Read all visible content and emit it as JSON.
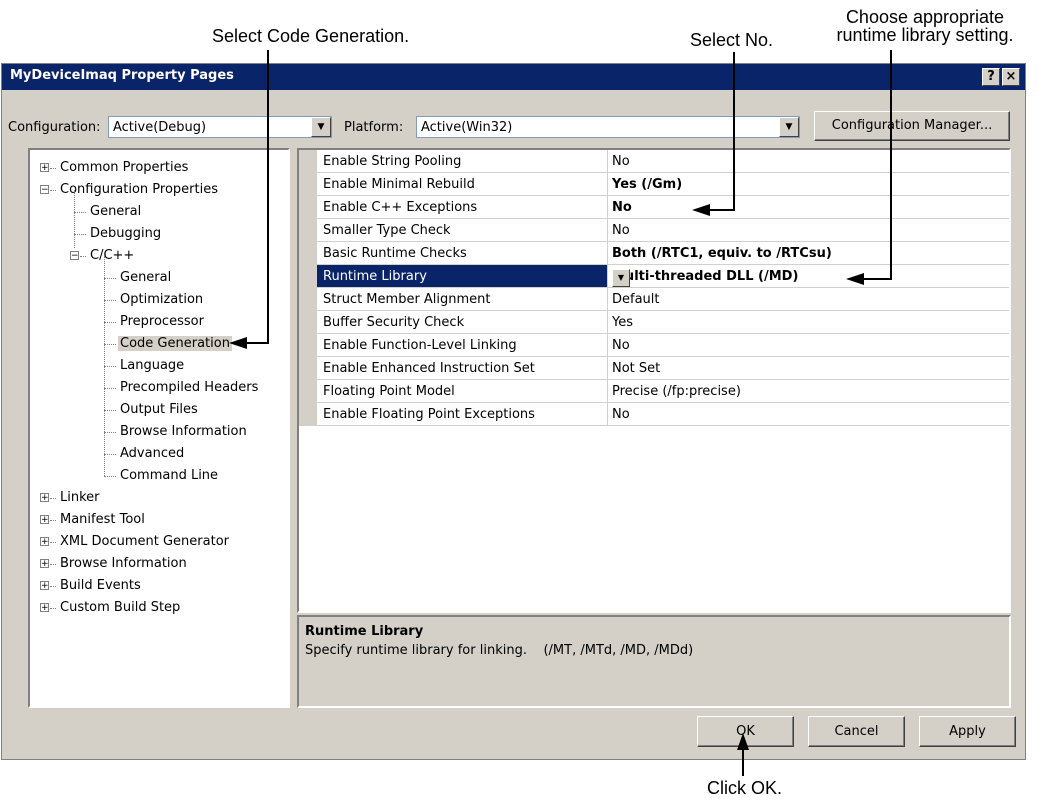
{
  "callouts": {
    "select_code_generation": "Select Code Generation.",
    "select_no": "Select No.",
    "choose_runtime_line1": "Choose appropriate",
    "choose_runtime_line2": "runtime library setting.",
    "click_ok": "Click OK."
  },
  "window": {
    "title": "MyDeviceImaq Property Pages",
    "help_button": "?",
    "close_button": "×"
  },
  "toolbar": {
    "configuration_label": "Configuration:",
    "configuration_value": "Active(Debug)",
    "platform_label": "Platform:",
    "platform_value": "Active(Win32)",
    "configuration_manager": "Configuration Manager..."
  },
  "tree": {
    "items": [
      {
        "label": "Common Properties",
        "expander": "+"
      },
      {
        "label": "Configuration Properties",
        "expander": "−"
      },
      {
        "label": "General"
      },
      {
        "label": "Debugging"
      },
      {
        "label": "C/C++",
        "expander": "−"
      },
      {
        "label": "General"
      },
      {
        "label": "Optimization"
      },
      {
        "label": "Preprocessor"
      },
      {
        "label": "Code Generation",
        "selected": true
      },
      {
        "label": "Language"
      },
      {
        "label": "Precompiled Headers"
      },
      {
        "label": "Output Files"
      },
      {
        "label": "Browse Information"
      },
      {
        "label": "Advanced"
      },
      {
        "label": "Command Line"
      },
      {
        "label": "Linker",
        "expander": "+"
      },
      {
        "label": "Manifest Tool",
        "expander": "+"
      },
      {
        "label": "XML Document Generator",
        "expander": "+"
      },
      {
        "label": "Browse Information",
        "expander": "+"
      },
      {
        "label": "Build Events",
        "expander": "+"
      },
      {
        "label": "Custom Build Step",
        "expander": "+"
      }
    ]
  },
  "properties": {
    "rows": [
      {
        "name": "Enable String Pooling",
        "value": "No"
      },
      {
        "name": "Enable Minimal Rebuild",
        "value": "Yes (/Gm)",
        "bold": true
      },
      {
        "name": "Enable C++ Exceptions",
        "value": "No",
        "bold": true
      },
      {
        "name": "Smaller Type Check",
        "value": "No"
      },
      {
        "name": "Basic Runtime Checks",
        "value": "Both (/RTC1, equiv. to /RTCsu)",
        "bold": true
      },
      {
        "name": "Runtime Library",
        "value": "Multi-threaded DLL (/MD)",
        "bold": true,
        "selected": true
      },
      {
        "name": "Struct Member Alignment",
        "value": "Default"
      },
      {
        "name": "Buffer Security Check",
        "value": "Yes"
      },
      {
        "name": "Enable Function-Level Linking",
        "value": "No"
      },
      {
        "name": "Enable Enhanced Instruction Set",
        "value": "Not Set"
      },
      {
        "name": "Floating Point Model",
        "value": "Precise (/fp:precise)"
      },
      {
        "name": "Enable Floating Point Exceptions",
        "value": "No"
      }
    ]
  },
  "description": {
    "title": "Runtime Library",
    "text": "Specify runtime library for linking.    (/MT, /MTd, /MD, /MDd)"
  },
  "buttons": {
    "ok": "OK",
    "cancel": "Cancel",
    "apply": "Apply"
  }
}
